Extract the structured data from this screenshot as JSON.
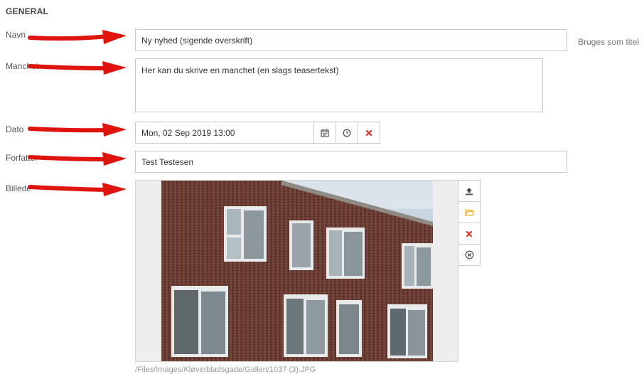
{
  "section": {
    "title": "GENERAL"
  },
  "fields": {
    "navn": {
      "label": "Navn",
      "value": "Ny nyhed (sigende overskrift)",
      "helper": "Bruges som titel"
    },
    "manchet": {
      "label": "Manchet",
      "value": "Her kan du skrive en manchet (en slags teasertekst)"
    },
    "dato": {
      "label": "Dato",
      "value": "Mon, 02 Sep 2019 13:00"
    },
    "forfatter": {
      "label": "Forfatter",
      "value": "Test Testesen"
    },
    "billede": {
      "label": "Billede",
      "path": "/Files/Images/Kløverbladsgade/Galleri/1037 (3).JPG"
    }
  },
  "icons": {
    "calendar": "calendar-icon",
    "clock": "clock-icon",
    "clear": "x-icon",
    "upload": "upload-icon",
    "folder": "folder-icon",
    "remove": "x-icon",
    "cancel": "circle-x-icon"
  },
  "colors": {
    "arrow": "#e0140f",
    "accent_red": "#d9332b",
    "folder": "#f0b429"
  }
}
